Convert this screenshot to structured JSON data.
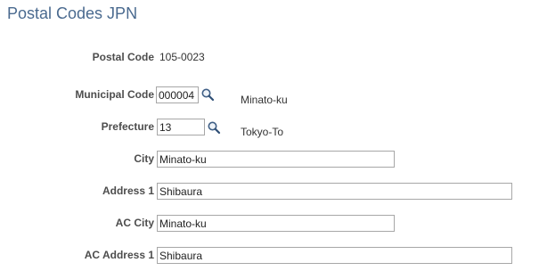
{
  "page": {
    "title": "Postal Codes JPN"
  },
  "form": {
    "postal_code": {
      "label": "Postal Code",
      "value": "105-0023"
    },
    "municipal_code": {
      "label": "Municipal Code",
      "value": "000004",
      "description": "Minato-ku",
      "lookup_icon": "search-icon"
    },
    "prefecture": {
      "label": "Prefecture",
      "value": "13",
      "description": "Tokyo-To",
      "lookup_icon": "search-icon"
    },
    "city": {
      "label": "City",
      "value": "Minato-ku"
    },
    "address1": {
      "label": "Address 1",
      "value": "Shibaura"
    },
    "ac_city": {
      "label": "AC City",
      "value": "Minato-ku"
    },
    "ac_address1": {
      "label": "AC Address 1",
      "value": "Shibaura"
    }
  },
  "colors": {
    "title": "#4a6a8f",
    "label": "#4d4d4d",
    "input_border": "#a7a7a7"
  }
}
